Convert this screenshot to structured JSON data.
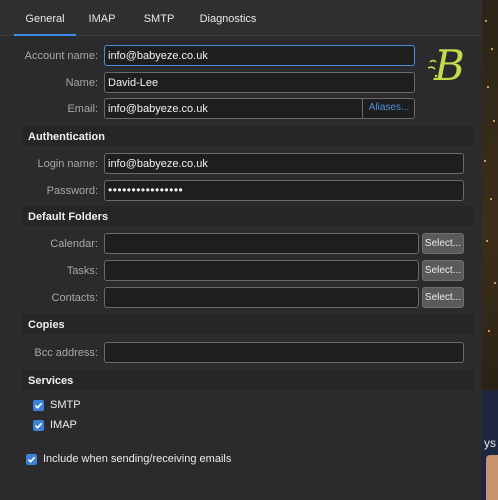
{
  "tabs": [
    {
      "label": "General",
      "active": true
    },
    {
      "label": "IMAP",
      "active": false
    },
    {
      "label": "SMTP",
      "active": false
    },
    {
      "label": "Diagnostics",
      "active": false
    }
  ],
  "account": {
    "account_name_label": "Account name:",
    "account_name_value": "info@babyeze.co.uk",
    "name_label": "Name:",
    "name_value": "David-Lee",
    "email_label": "Email:",
    "email_value": "info@babyeze.co.uk",
    "aliases_button": "Aliases..."
  },
  "logo": {
    "letter": "B",
    "color": "#c5d94a",
    "name": "babyeze-logo"
  },
  "authentication": {
    "title": "Authentication",
    "login_label": "Login name:",
    "login_value": "info@babyeze.co.uk",
    "password_label": "Password:",
    "password_value": "••••••••••••••••"
  },
  "default_folders": {
    "title": "Default Folders",
    "calendar_label": "Calendar:",
    "calendar_value": "",
    "tasks_label": "Tasks:",
    "tasks_value": "",
    "contacts_label": "Contacts:",
    "contacts_value": "",
    "select_button": "Select..."
  },
  "copies": {
    "title": "Copies",
    "bcc_label": "Bcc address:",
    "bcc_value": ""
  },
  "services": {
    "title": "Services",
    "items": [
      {
        "label": "SMTP",
        "checked": true
      },
      {
        "label": "IMAP",
        "checked": true
      }
    ]
  },
  "include_option": {
    "label": "Include when sending/receiving emails",
    "checked": true
  },
  "background_text": "ys",
  "colors": {
    "accent": "#3b8ee6",
    "panel": "#2b2b2d",
    "input_bg": "#1e1e1f",
    "checkbox": "#3b82d8"
  }
}
